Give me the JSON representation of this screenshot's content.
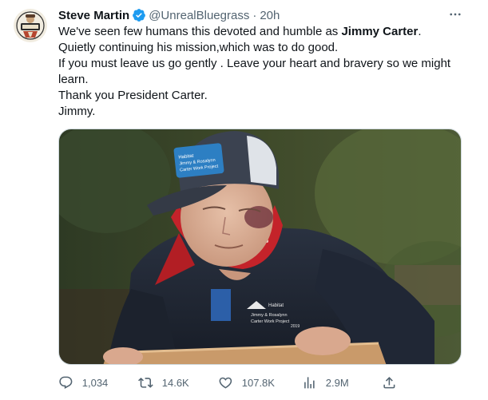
{
  "author": {
    "name": "Steve Martin",
    "handle": "@UnrealBluegrass",
    "separator": "·",
    "time": "20h"
  },
  "tweet": {
    "line1_pre": "We've seen few humans this devoted and humble as ",
    "line1_bold": "Jimmy Carter",
    "line1_post": ".",
    "line2": "Quietly continuing his mission,which was to do good.",
    "line3": "If you must leave us go gently . Leave your heart and bravery so we might learn.",
    "line4": "Thank you President Carter.",
    "line5": "Jimmy."
  },
  "media": {
    "cap_patch_line1": "Habitat",
    "cap_patch_line2": "Jimmy & Rosalynn",
    "cap_patch_line3": "Carter Work Project",
    "jacket_logo_line1": "Habitat",
    "jacket_logo_line2": "Jimmy & Rosalynn",
    "jacket_logo_line3": "Carter Work Project",
    "jacket_logo_year": "2019"
  },
  "actions": {
    "replies": "1,034",
    "retweets": "14.6K",
    "likes": "107.8K",
    "views": "2.9M"
  },
  "icons": {
    "verified": "verified-badge-icon",
    "more": "more-options-icon",
    "reply": "reply-icon",
    "retweet": "retweet-icon",
    "like": "heart-icon",
    "views": "views-icon",
    "share": "share-icon"
  },
  "colors": {
    "verified": "#1d9bf0",
    "text_primary": "#0f1419",
    "text_secondary": "#536471",
    "border": "#cfd9de"
  }
}
